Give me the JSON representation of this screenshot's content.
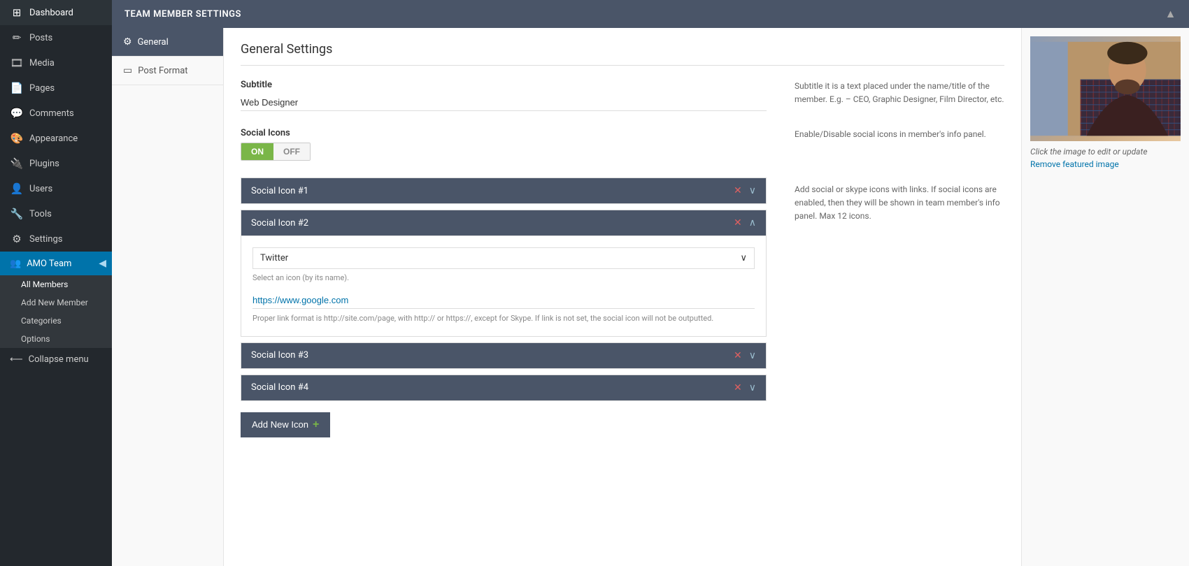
{
  "adminbar": {},
  "sidebar": {
    "items": [
      {
        "id": "dashboard",
        "label": "Dashboard",
        "icon": "⊞"
      },
      {
        "id": "posts",
        "label": "Posts",
        "icon": "✎"
      },
      {
        "id": "media",
        "label": "Media",
        "icon": "🎞"
      },
      {
        "id": "pages",
        "label": "Pages",
        "icon": "📄"
      },
      {
        "id": "comments",
        "label": "Comments",
        "icon": "💬"
      },
      {
        "id": "appearance",
        "label": "Appearance",
        "icon": "🎨"
      },
      {
        "id": "plugins",
        "label": "Plugins",
        "icon": "🔌"
      },
      {
        "id": "users",
        "label": "Users",
        "icon": "👤"
      },
      {
        "id": "tools",
        "label": "Tools",
        "icon": "🔧"
      },
      {
        "id": "settings",
        "label": "Settings",
        "icon": "⚙"
      }
    ],
    "amo_team": {
      "label": "AMO Team",
      "icon": "👥"
    },
    "submenu": [
      {
        "id": "all-members",
        "label": "All Members"
      },
      {
        "id": "add-new-member",
        "label": "Add New Member"
      },
      {
        "id": "categories",
        "label": "Categories"
      },
      {
        "id": "options",
        "label": "Options"
      }
    ],
    "collapse": "Collapse menu"
  },
  "team_member_settings": {
    "header": "TEAM MEMBER SETTINGS",
    "tabs": [
      {
        "id": "general",
        "label": "General",
        "icon": "⚙"
      },
      {
        "id": "post-format",
        "label": "Post Format",
        "icon": "▭"
      }
    ],
    "general": {
      "title": "General Settings",
      "subtitle": {
        "label": "Subtitle",
        "value": "Web Designer",
        "description": "Subtitle it is a text placed under the name/title of the member. E.g. – CEO, Graphic Designer, Film Director, etc."
      },
      "social_icons": {
        "label": "Social Icons",
        "toggle_on": "ON",
        "toggle_off": "OFF",
        "description": "Enable/Disable social icons in member's info panel."
      },
      "social_panels": {
        "description": "Add social or skype icons with links. If social icons are enabled, then they will be shown in team member's info panel. Max 12 icons.",
        "items": [
          {
            "id": 1,
            "label": "Social Icon #1",
            "expanded": false
          },
          {
            "id": 2,
            "label": "Social Icon #2",
            "expanded": true,
            "select_value": "Twitter",
            "select_hint": "Select an icon (by its name).",
            "url_value": "https://www.google.com",
            "url_hint": "Proper link format is http://site.com/page, with http:// or https://, except for Skype. If link is not set, the social icon will not be outputted."
          },
          {
            "id": 3,
            "label": "Social Icon #3",
            "expanded": false
          },
          {
            "id": 4,
            "label": "Social Icon #4",
            "expanded": false
          }
        ],
        "add_button": "Add New Icon"
      }
    }
  },
  "featured_image": {
    "click_hint": "Click the image to edit or update",
    "remove_label": "Remove featured image"
  }
}
